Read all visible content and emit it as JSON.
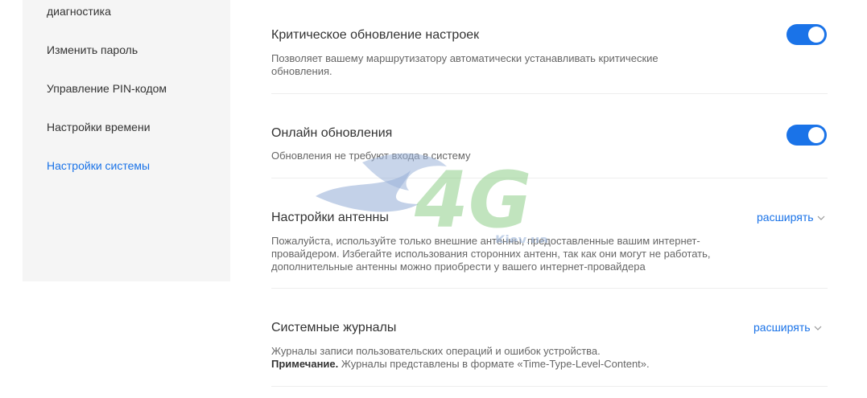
{
  "sidebar": {
    "items": [
      {
        "label": "диагностика",
        "active": false
      },
      {
        "label": "Изменить пароль",
        "active": false
      },
      {
        "label": "Управление PIN-кодом",
        "active": false
      },
      {
        "label": "Настройки времени",
        "active": false
      },
      {
        "label": "Настройки системы",
        "active": true
      }
    ]
  },
  "sections": {
    "critical_update": {
      "title": "Критическое обновление настроек",
      "desc": "Позволяет вашему маршрутизатору автоматически устанавливать критические обновления.",
      "enabled": true
    },
    "online_update": {
      "title": "Онлайн обновления",
      "desc": "Обновления не требуют входа в систему",
      "enabled": true
    },
    "antenna": {
      "title": "Настройки антенны",
      "expand_label": "расширять",
      "desc": "Пожалуйста, используйте только внешние антенны, предоставленные вашим интернет-провайдером. Избегайте использования сторонних антенн, так как они могут не работать, дополнительные антенны можно приобрести у вашего интернет-провайдера"
    },
    "system_logs": {
      "title": "Системные журналы",
      "expand_label": "расширять",
      "desc": "Журналы записи пользовательских операций и ошибок устройства.",
      "note_label": "Примечание.",
      "note_text": " Журналы представлены в формате «Time-Type-Level-Content»."
    }
  },
  "watermark": {
    "logo_text": "4G",
    "site_text": "Kiev.ua"
  },
  "colors": {
    "accent": "#1a73e8",
    "sidebar_bg": "#f5f5f5",
    "divider": "#eeeeee"
  }
}
